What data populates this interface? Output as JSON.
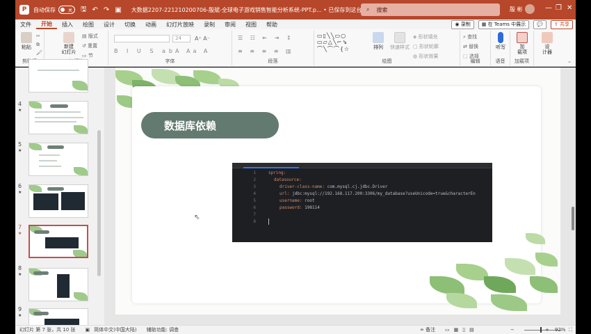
{
  "titlebar": {
    "logo": "P",
    "autosave_label": "自动保存",
    "autosave_state": "关",
    "doc_title": "大数据2207-221210200706-殷斌-全球电子游戏销售智能分析系统-PPT.p... • 已保存到这台电脑",
    "search_placeholder": "搜索",
    "user": "殷 彬"
  },
  "menu": {
    "tabs": [
      "文件",
      "开始",
      "插入",
      "绘图",
      "设计",
      "切换",
      "动画",
      "幻灯片放映",
      "录制",
      "审阅",
      "视图",
      "帮助"
    ],
    "active": "开始",
    "record_label": "录制",
    "teams_label": "在 Teams 中展示",
    "share_label": "共享"
  },
  "ribbon": {
    "groups": {
      "clipboard": "剪贴板",
      "slides": "幻灯片",
      "font": "字体",
      "paragraph": "段落",
      "drawing": "绘图",
      "editing": "编辑",
      "voice": "语音",
      "addins": "加载项"
    },
    "paste": "粘贴",
    "new_slide": "新建\n幻灯片",
    "layout": "版式",
    "reset": "重置",
    "section": "节",
    "font_size": "24",
    "arrange": "排列",
    "quick_styles": "快速样式",
    "shape_fill": "形状填充",
    "shape_outline": "形状轮廓",
    "shape_effects": "形状效果",
    "find": "查找",
    "replace": "替换",
    "select": "选择",
    "dictate": "听写",
    "addins_btn": "加\n载项",
    "designer": "设\n计器"
  },
  "thumbnails": [
    {
      "num": "",
      "starred": false
    },
    {
      "num": "4",
      "starred": true
    },
    {
      "num": "5",
      "starred": true
    },
    {
      "num": "6",
      "starred": true
    },
    {
      "num": "7",
      "starred": true,
      "active": true
    },
    {
      "num": "8",
      "starred": true
    },
    {
      "num": "9",
      "starred": true
    }
  ],
  "slide": {
    "title": "数据库依赖",
    "code": [
      {
        "n": "1",
        "text": "spring:",
        "indent": 0,
        "kind": "key"
      },
      {
        "n": "2",
        "text": "datasource:",
        "indent": 1,
        "kind": "key"
      },
      {
        "n": "3",
        "text": "driver-class-name: com.mysql.cj.jdbc.Driver",
        "indent": 2,
        "kind": "pair"
      },
      {
        "n": "4",
        "text": "url: jdbc:mysql://192.168.117.200:3306/my_database?useUnicode=true&characterEn",
        "indent": 2,
        "kind": "pair"
      },
      {
        "n": "5",
        "text": "username: root",
        "indent": 2,
        "kind": "pair"
      },
      {
        "n": "6",
        "text": "password: 198114",
        "indent": 2,
        "kind": "pair"
      },
      {
        "n": "7",
        "text": "",
        "indent": 0,
        "kind": "blank"
      },
      {
        "n": "8",
        "text": "",
        "indent": 0,
        "kind": "blank"
      }
    ]
  },
  "status": {
    "slide_info": "幻灯片 第 7 张，共 10 张",
    "language": "简体中文(中国大陆)",
    "accessibility": "辅助功能: 调查",
    "notes": "备注",
    "zoom": "92%"
  }
}
